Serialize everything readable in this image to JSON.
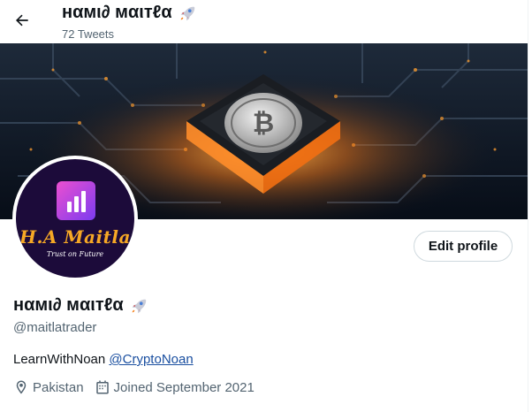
{
  "header": {
    "display_name": "нαмι∂ мαιтℓα",
    "tweet_count": "72 Tweets",
    "back_icon": "arrow-left-icon",
    "emoji_icon": "rocket-icon"
  },
  "banner": {
    "image": "bitcoin-chip-circuit-banner",
    "accent": "#ff9a2e"
  },
  "avatar": {
    "brand_text": "H.A Maitla",
    "tagline": "Trust on Future"
  },
  "actions": {
    "edit_profile_label": "Edit profile"
  },
  "profile": {
    "display_name": "нαмι∂ мαιтℓα",
    "handle": "@maitlatrader",
    "bio_text": "LearnWithNoan",
    "bio_link": "@CryptoNoan",
    "location": "Pakistan",
    "joined": "Joined September 2021",
    "location_icon": "location-pin-icon",
    "calendar_icon": "calendar-icon"
  },
  "colors": {
    "text_primary": "#0f1419",
    "text_secondary": "#536471",
    "link": "#1a4fa0",
    "border": "#cfd9de"
  }
}
